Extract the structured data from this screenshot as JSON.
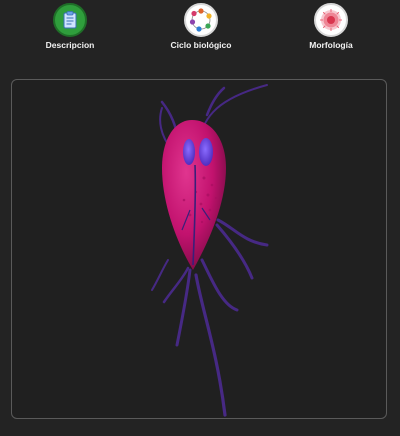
{
  "nav": {
    "items": [
      {
        "label": "Descripcion",
        "icon": "clipboard-icon"
      },
      {
        "label": "Ciclo biológico",
        "icon": "lifecycle-icon"
      },
      {
        "label": "Morfología",
        "icon": "cell-icon"
      }
    ]
  },
  "viewer": {
    "subject": "giardia-3d-model",
    "colors": {
      "body": "#c2126e",
      "nuclei": "#5a2ccf",
      "flagella": "#4b2a8f"
    }
  }
}
